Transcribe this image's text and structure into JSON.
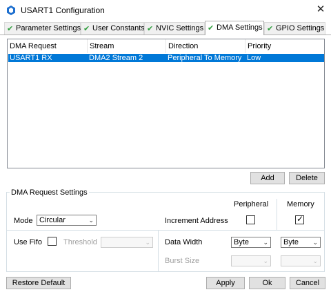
{
  "window": {
    "title": "USART1 Configuration",
    "close_glyph": "✕"
  },
  "tabs": [
    {
      "label": "Parameter Settings",
      "check": "✔"
    },
    {
      "label": "User Constants",
      "check": "✔"
    },
    {
      "label": "NVIC Settings",
      "check": "✔"
    },
    {
      "label": "DMA Settings",
      "check": "✔",
      "active": true
    },
    {
      "label": "GPIO Settings",
      "check": "✔"
    }
  ],
  "table": {
    "headers": [
      "DMA Request",
      "Stream",
      "Direction",
      "Priority"
    ],
    "rows": [
      {
        "request": "USART1 RX",
        "stream": "DMA2 Stream 2",
        "direction": "Peripheral To Memory",
        "priority": "Low"
      }
    ]
  },
  "table_buttons": {
    "add": "Add",
    "delete": "Delete"
  },
  "settings": {
    "group_title": "DMA Request Settings",
    "col_peripheral": "Peripheral",
    "col_memory": "Memory",
    "mode_label": "Mode",
    "mode_value": "Circular",
    "increment_label": "Increment Address",
    "peripheral_increment": false,
    "memory_increment": true,
    "checkmark": "✓",
    "use_fifo_label": "Use Fifo",
    "threshold_label": "Threshold",
    "threshold_value": "",
    "data_width_label": "Data Width",
    "peripheral_width": "Byte",
    "memory_width": "Byte",
    "burst_size_label": "Burst Size",
    "dropdown_arrow": "⌄"
  },
  "footer": {
    "restore": "Restore Default",
    "apply": "Apply",
    "ok": "Ok",
    "cancel": "Cancel"
  }
}
